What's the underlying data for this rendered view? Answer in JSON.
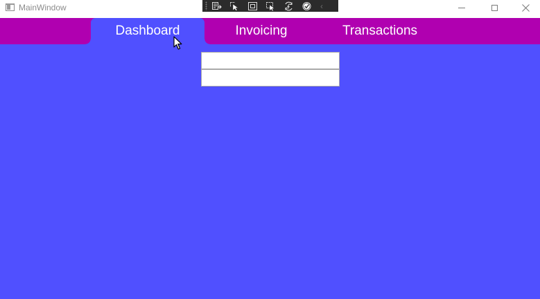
{
  "window": {
    "title": "MainWindow",
    "background_color": "#5050ff",
    "caption_buttons": [
      {
        "icon": "minimize-icon"
      },
      {
        "icon": "maximize-icon"
      },
      {
        "icon": "close-icon"
      }
    ]
  },
  "debug_toolbar": {
    "icons": [
      "go-to-live-visual-tree-icon",
      "select-element-icon",
      "display-layout-adorners-icon",
      "track-focused-element-icon",
      "hot-reload-icon",
      "binding-failures-check-icon",
      "collapse-chevron-icon"
    ]
  },
  "tabs": {
    "strip_color": "#b000b0",
    "selected_color": "#5050ff",
    "items": [
      {
        "label": "Dashboard",
        "selected": true
      },
      {
        "label": "Invoicing",
        "selected": false
      },
      {
        "label": "Transactions",
        "selected": false
      }
    ]
  },
  "content": {
    "inputs": [
      {
        "value": "",
        "placeholder": ""
      },
      {
        "value": "",
        "placeholder": ""
      }
    ]
  }
}
